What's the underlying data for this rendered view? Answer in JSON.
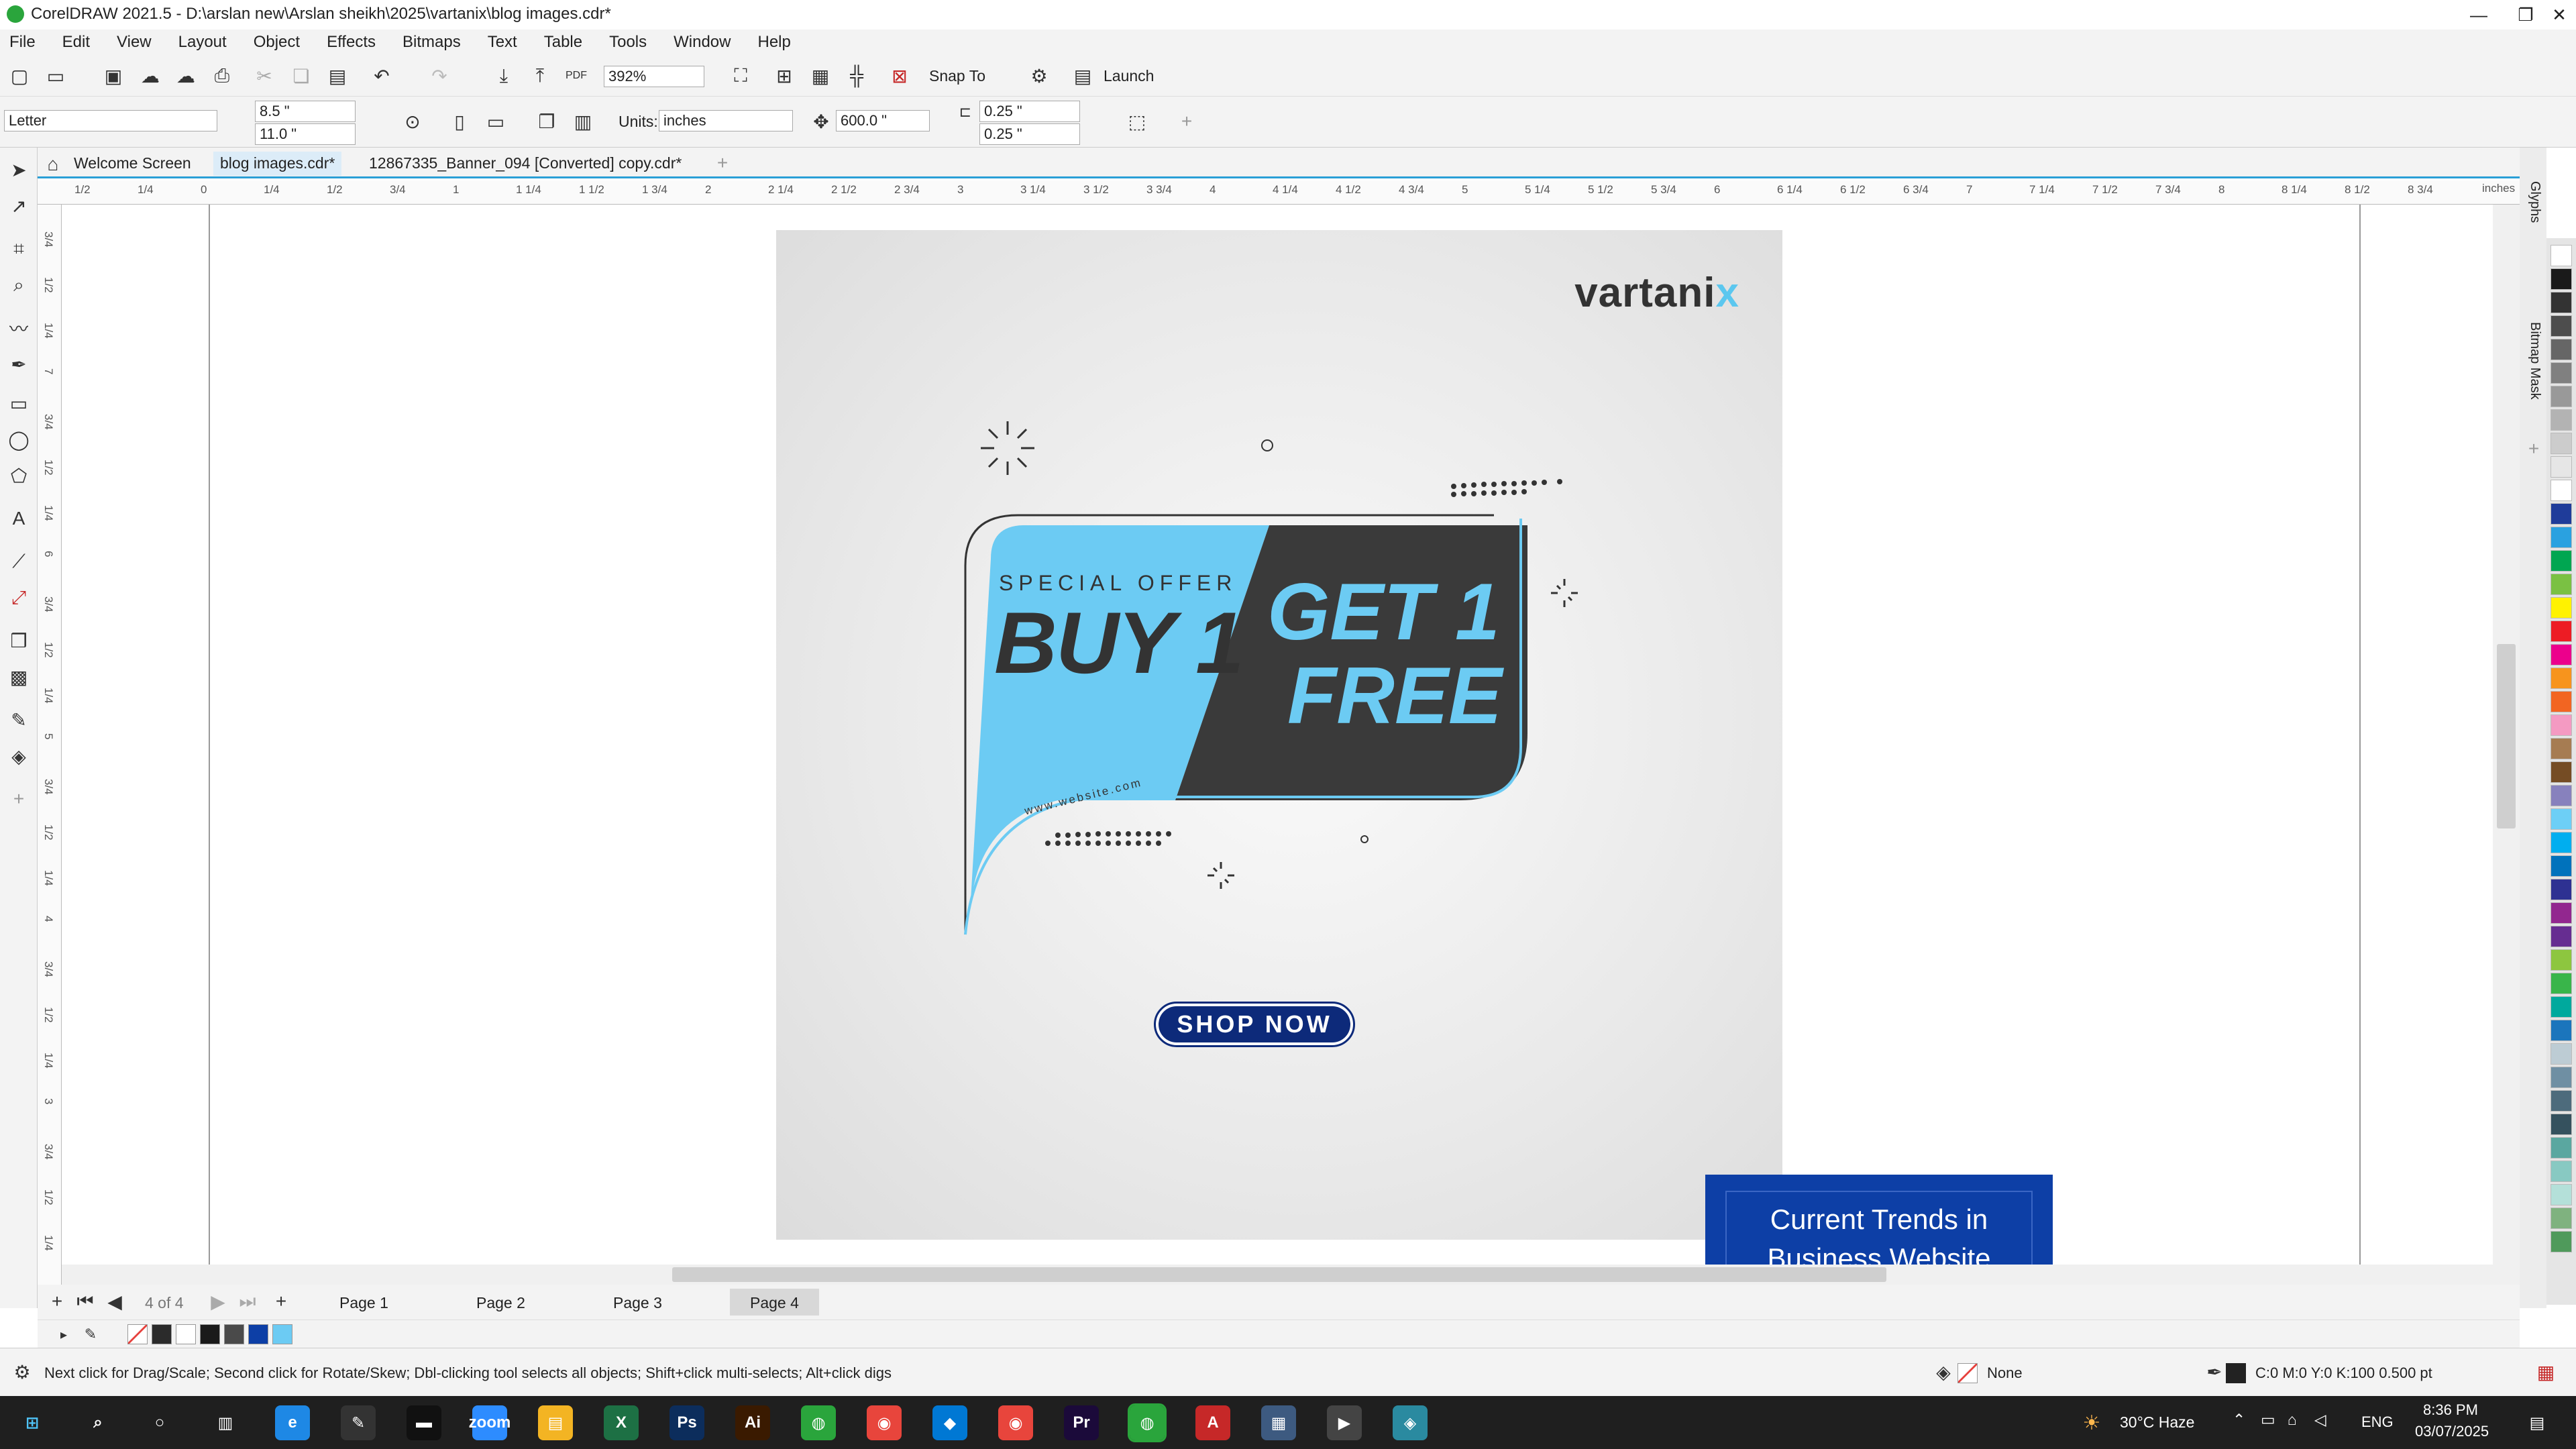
{
  "window": {
    "title": "CorelDRAW 2021.5 - D:\\arslan new\\Arslan sheikh\\2025\\vartanix\\blog images.cdr*"
  },
  "menu": [
    "File",
    "Edit",
    "View",
    "Layout",
    "Object",
    "Effects",
    "Bitmaps",
    "Text",
    "Table",
    "Tools",
    "Window",
    "Help"
  ],
  "toolbar": {
    "zoom": "392%",
    "snap_label": "Snap To",
    "launch_label": "Launch"
  },
  "property_bar": {
    "page_size": "Letter",
    "width": "8.5 \"",
    "height": "11.0 \"",
    "units_label": "Units:",
    "units": "inches",
    "nudge": "600.0 \"",
    "dup_x": "0.25 \"",
    "dup_y": "0.25 \""
  },
  "tabs": [
    {
      "label": "Welcome Screen"
    },
    {
      "label": "blog images.cdr*",
      "active": true
    },
    {
      "label": "12867335_Banner_094 [Converted] copy.cdr*"
    }
  ],
  "ruler": {
    "unit": "inches",
    "h_labels": [
      "1/2",
      "1/4",
      "0",
      "1/4",
      "1/2",
      "3/4",
      "1",
      "1 1/4",
      "1 1/2",
      "1 3/4",
      "2",
      "2 1/4",
      "2 1/2",
      "2 3/4",
      "3",
      "3 1/4",
      "3 1/2",
      "3 3/4",
      "4",
      "4 1/4",
      "4 1/2",
      "4 3/4",
      "5",
      "5 1/4",
      "5 1/2",
      "5 3/4",
      "6",
      "6 1/4",
      "6 1/2",
      "6 3/4",
      "7",
      "7 1/4",
      "7 1/2",
      "7 3/4",
      "8",
      "8 1/4",
      "8 1/2",
      "8 3/4"
    ],
    "v_labels": [
      "3/4",
      "1/2",
      "1/4",
      "7",
      "3/4",
      "1/2",
      "1/4",
      "6",
      "3/4",
      "1/2",
      "1/4",
      "5",
      "3/4",
      "1/2",
      "1/4",
      "4",
      "3/4",
      "1/2",
      "1/4",
      "3",
      "3/4",
      "1/2",
      "1/4"
    ]
  },
  "artwork": {
    "brand": "vartani",
    "brand_accent": "x",
    "special_offer": "SPECIAL OFFER",
    "buy": "BUY 1",
    "get": "GET 1",
    "free": "FREE",
    "website": "www.website.com",
    "cta": "SHOP NOW",
    "colors": {
      "light_blue": "#6ccbf3",
      "dark": "#3a3a3a",
      "navy": "#0d2a7a"
    }
  },
  "bluecard": {
    "line1": "Current Trends in",
    "line2": "Business Website"
  },
  "pages": {
    "counter": "4 of 4",
    "tabs": [
      "Page 1",
      "Page 2",
      "Page 3",
      "Page 4"
    ],
    "active": "Page 4"
  },
  "dockers": [
    "Glyphs",
    "Bitmap Mask"
  ],
  "palette": [
    "#ffffff",
    "#1a1a1a",
    "#333333",
    "#4d4d4d",
    "#666666",
    "#808080",
    "#999999",
    "#b3b3b3",
    "#cccccc",
    "#e6e6e6",
    "#ffffff",
    "#1f3c9a",
    "#2aa1e0",
    "#00a651",
    "#7ac143",
    "#fff200",
    "#ed1c24",
    "#ec008c",
    "#f7941d",
    "#f26522",
    "#f49ac2",
    "#a67c52",
    "#754c24",
    "#8781bd",
    "#6dcff6",
    "#00aeef",
    "#0072bc",
    "#2e3192",
    "#92278f",
    "#662d91",
    "#8dc63f",
    "#39b54a",
    "#00a99d",
    "#1b75bc",
    "#bdccd4",
    "#6f8fa3",
    "#4d6b7c",
    "#35515e",
    "#5aa7a0",
    "#88c9c2",
    "#b4e0d9",
    "#7fb27f",
    "#4f9a5b"
  ],
  "document_colors": [
    "#2b2b2b",
    "#ffffff",
    "#1a1a1a",
    "#4a4a4a",
    "#0d3fa6",
    "#6ccbf3"
  ],
  "status": {
    "hint": "Next click for Drag/Scale; Second click for Rotate/Skew; Dbl-clicking tool selects all objects; Shift+click multi-selects; Alt+click digs",
    "fill": "None",
    "outline": "C:0 M:0 Y:0 K:100  0.500 pt"
  },
  "taskbar": {
    "weather": "30°C  Haze",
    "lang": "ENG",
    "time": "8:36 PM",
    "date": "03/07/2025",
    "apps": [
      {
        "label": "e",
        "color": "#1e88e5"
      },
      {
        "label": "✎",
        "color": "#333"
      },
      {
        "label": "▬",
        "color": "#111"
      },
      {
        "label": "zoom",
        "color": "#2d8cff"
      },
      {
        "label": "▤",
        "color": "#f3b423"
      },
      {
        "label": "X",
        "color": "#1d7044"
      },
      {
        "label": "Ps",
        "color": "#0c2d5c"
      },
      {
        "label": "Ai",
        "color": "#3a1a00"
      },
      {
        "label": "◍",
        "color": "#2aa53c"
      },
      {
        "label": "◉",
        "color": "#e8453c"
      },
      {
        "label": "◆",
        "color": "#0078d4"
      },
      {
        "label": "◉",
        "color": "#e8453c"
      },
      {
        "label": "Pr",
        "color": "#1b0a3a"
      },
      {
        "label": "◍",
        "color": "#2aa53c"
      },
      {
        "label": "A",
        "color": "#c62828"
      },
      {
        "label": "▦",
        "color": "#3d5a80"
      },
      {
        "label": "▶",
        "color": "#444"
      },
      {
        "label": "◈",
        "color": "#2a8aa0"
      }
    ]
  }
}
